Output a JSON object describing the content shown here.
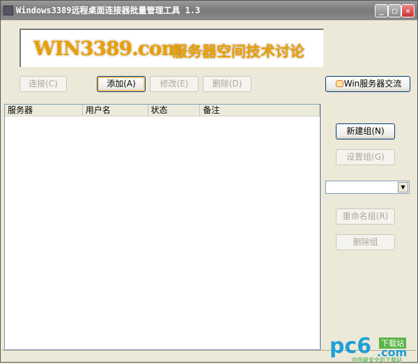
{
  "window": {
    "title": "Windows3389远程桌面连接器批量管理工具 1.3",
    "minimize": "_",
    "maximize": "□",
    "close": "✕"
  },
  "banner": {
    "brand": "WIN3389.com",
    "slogan": "服务器空间技术讨论"
  },
  "toolbar": {
    "connect": "连接(C)",
    "add": "添加(A)",
    "edit": "修改(E)",
    "delete": "删除(D)",
    "forum": "Win服务器交流"
  },
  "list": {
    "columns": [
      "服务器",
      "用户名",
      "状态",
      "备注"
    ]
  },
  "groups": {
    "new": "新建组(N)",
    "settings": "设置组(G)",
    "combo_value": "",
    "rename": "重命名组(R)",
    "delete": "删除组"
  },
  "watermark": {
    "logo": "pc6",
    "tag": "下载站",
    "domain": ".com",
    "sub": "中国最安全的下载站"
  }
}
